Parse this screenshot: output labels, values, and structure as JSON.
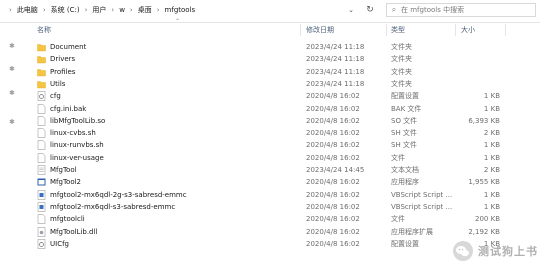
{
  "breadcrumb": [
    "此电脑",
    "系统 (C:)",
    "用户",
    "w",
    "桌面",
    "mfgtools"
  ],
  "search": {
    "placeholder": "在 mfgtools 中搜索"
  },
  "columns": {
    "name": "名称",
    "date": "修改日期",
    "type": "类型",
    "size": "大小"
  },
  "files": [
    {
      "name": "Document",
      "date": "2023/4/24 11:18",
      "type": "文件夹",
      "size": "",
      "icon": "folder-icon"
    },
    {
      "name": "Drivers",
      "date": "2023/4/24 11:18",
      "type": "文件夹",
      "size": "",
      "icon": "folder-icon"
    },
    {
      "name": "Profiles",
      "date": "2023/4/24 11:18",
      "type": "文件夹",
      "size": "",
      "icon": "folder-icon"
    },
    {
      "name": "Utils",
      "date": "2023/4/24 11:18",
      "type": "文件夹",
      "size": "",
      "icon": "folder-icon"
    },
    {
      "name": "cfg",
      "date": "2020/4/8 16:02",
      "type": "配置设置",
      "size": "1 KB",
      "icon": "config-file-icon"
    },
    {
      "name": "cfg.ini.bak",
      "date": "2020/4/8 16:02",
      "type": "BAK 文件",
      "size": "1 KB",
      "icon": "file-icon"
    },
    {
      "name": "libMfgToolLib.so",
      "date": "2020/4/8 16:02",
      "type": "SO 文件",
      "size": "6,393 KB",
      "icon": "file-icon"
    },
    {
      "name": "linux-cvbs.sh",
      "date": "2020/4/8 16:02",
      "type": "SH 文件",
      "size": "2 KB",
      "icon": "file-icon"
    },
    {
      "name": "linux-runvbs.sh",
      "date": "2020/4/8 16:02",
      "type": "SH 文件",
      "size": "1 KB",
      "icon": "file-icon"
    },
    {
      "name": "linux-ver-usage",
      "date": "2020/4/8 16:02",
      "type": "文件",
      "size": "1 KB",
      "icon": "file-icon"
    },
    {
      "name": "MfgTool",
      "date": "2023/4/24 14:45",
      "type": "文本文档",
      "size": "2 KB",
      "icon": "text-file-icon"
    },
    {
      "name": "MfgTool2",
      "date": "2020/4/8 16:02",
      "type": "应用程序",
      "size": "1,955 KB",
      "icon": "app-icon"
    },
    {
      "name": "mfgtool2-mx6qdl-2g-s3-sabresd-emmc",
      "date": "2020/4/8 16:02",
      "type": "VBScript Script ...",
      "size": "1 KB",
      "icon": "script-icon"
    },
    {
      "name": "mfgtool2-mx6qdl-s3-sabresd-emmc",
      "date": "2020/4/8 16:02",
      "type": "VBScript Script ...",
      "size": "1 KB",
      "icon": "script-icon"
    },
    {
      "name": "mfgtoolcli",
      "date": "2020/4/8 16:02",
      "type": "文件",
      "size": "200 KB",
      "icon": "file-icon"
    },
    {
      "name": "MfgToolLib.dll",
      "date": "2020/4/8 16:02",
      "type": "应用程序扩展",
      "size": "2,192 KB",
      "icon": "dll-icon"
    },
    {
      "name": "UICfg",
      "date": "2020/4/8 16:02",
      "type": "配置设置",
      "size": "1 KB",
      "icon": "config-file-icon"
    }
  ],
  "watermark": {
    "text": "测试狗上书"
  },
  "colors": {
    "folder": "#f5c542",
    "header_text": "#4c607a",
    "secondary_text": "#6d6d6d",
    "app_icon": "#2b5fab"
  }
}
